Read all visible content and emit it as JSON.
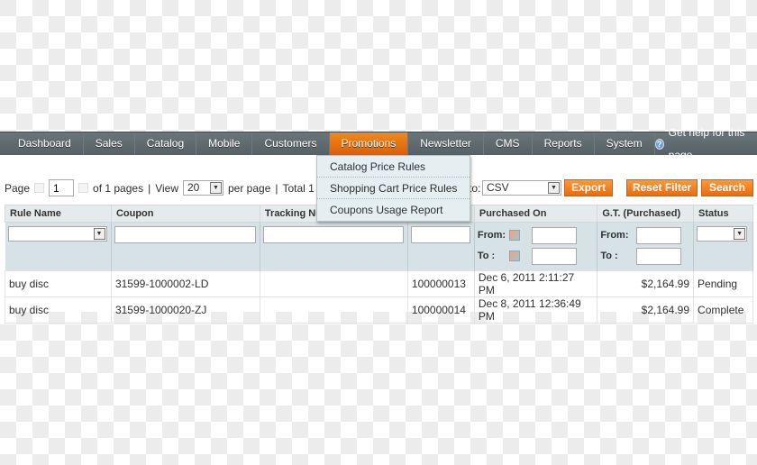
{
  "nav": {
    "items": [
      "Dashboard",
      "Sales",
      "Catalog",
      "Mobile",
      "Customers",
      "Promotions",
      "Newsletter",
      "CMS",
      "Reports",
      "System"
    ],
    "active": "Promotions",
    "help": "Get help for this page"
  },
  "dropdown": {
    "items": [
      "Catalog Price Rules",
      "Shopping Cart Price Rules",
      "Coupons Usage Report"
    ]
  },
  "pager": {
    "page_label": "Page",
    "page": "1",
    "of_pages": "of 1 pages",
    "sep": "|",
    "view_label": "View",
    "per_page": "20",
    "per_page_label": "per page",
    "total": "Total 1"
  },
  "export": {
    "to_label": "to:",
    "format": "CSV",
    "button": "Export"
  },
  "buttons": {
    "reset": "Reset Filter",
    "search": "Search"
  },
  "filters": {
    "from": "From:",
    "to": "To :"
  },
  "colors": {
    "accent": "#eb7314",
    "nav": "#5f6a6f"
  },
  "table": {
    "headers": [
      "Rule Name",
      "Coupon",
      "Tracking Nu",
      "",
      "Purchased On",
      "G.T. (Purchased)",
      "Status"
    ],
    "rows": [
      [
        "buy disc",
        "31599-1000002-LD",
        "",
        "100000013",
        "Dec 6, 2011 2:11:27 PM",
        "$2,164.99",
        "Pending"
      ],
      [
        "buy disc",
        "31599-1000020-ZJ",
        "",
        "100000014",
        "Dec 8, 2011 12:36:49 PM",
        "$2,164.99",
        "Complete"
      ]
    ]
  }
}
